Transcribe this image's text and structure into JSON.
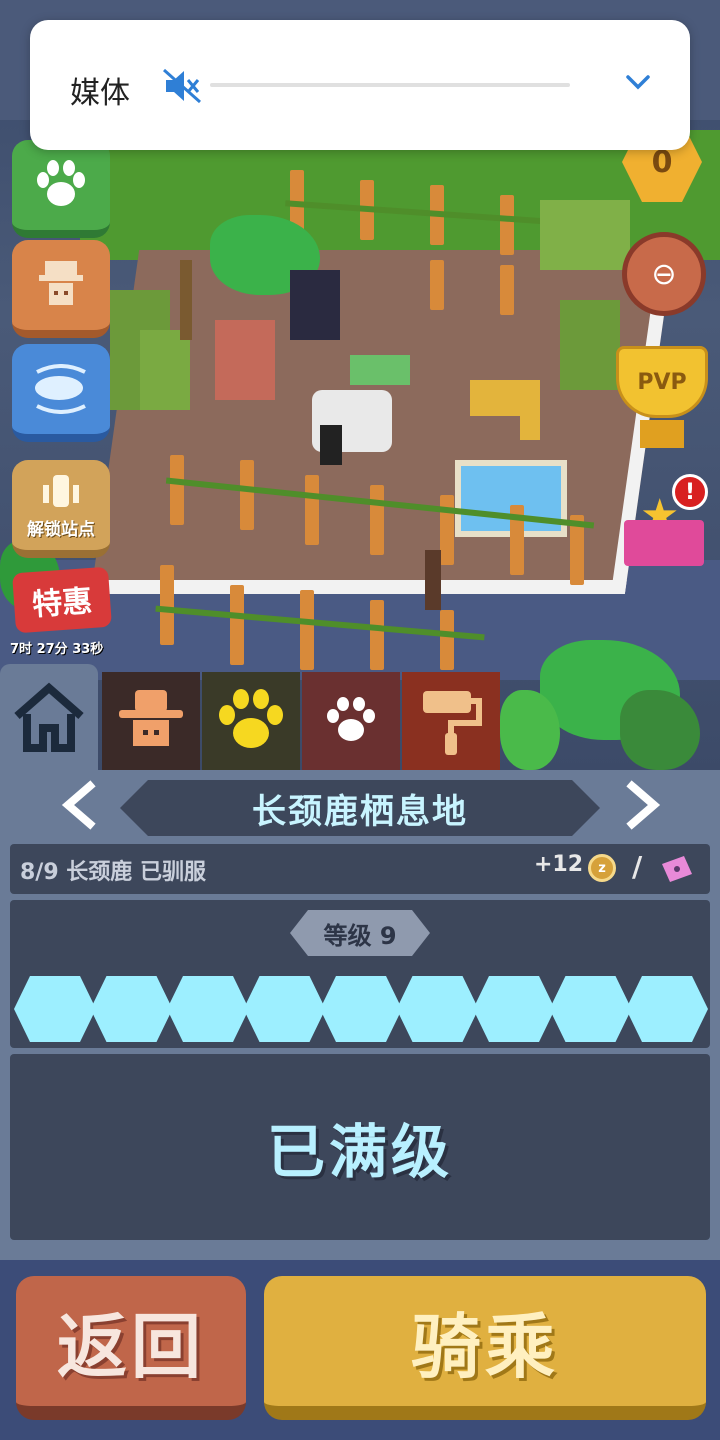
{
  "media_popup": {
    "label": "媒体",
    "icon": "volume-muted-icon",
    "expand_icon": "chevron-down-icon",
    "volume": 0
  },
  "left_buttons": [
    {
      "icon": "paw-icon"
    },
    {
      "icon": "ranger-icon"
    },
    {
      "icon": "blimp-icon"
    },
    {
      "icon": "station-icon",
      "label": "解锁站点"
    }
  ],
  "deal": {
    "label": "特惠",
    "timer": "7时 27分 33秒"
  },
  "right_buttons": {
    "hex_coin_value": "0",
    "pvp_label": "PVP",
    "gift_alert": "!"
  },
  "tabs": [
    {
      "icon": "home-icon",
      "active": true
    },
    {
      "icon": "cowboy-icon",
      "active": false
    },
    {
      "icon": "paw-icon",
      "active": false
    },
    {
      "icon": "paw-print-icon",
      "active": false
    },
    {
      "icon": "paint-roller-icon",
      "active": false
    }
  ],
  "habitat": {
    "title": "长颈鹿栖息地",
    "tamed_text": "8/9 长颈鹿 已驯服",
    "reward": "+12",
    "coin_icon": "z",
    "separator": "/",
    "level_label": "等级 9",
    "level_progress": 1.0,
    "segments": 9,
    "max_text": "已满级"
  },
  "buttons": {
    "back": "返回",
    "ride": "骑乘"
  },
  "colors": {
    "panel": "#6a7b97",
    "panel_dark": "#3d475b",
    "segment": "#9defff",
    "back_button": "#c0664a",
    "ride_button": "#e0b040"
  }
}
